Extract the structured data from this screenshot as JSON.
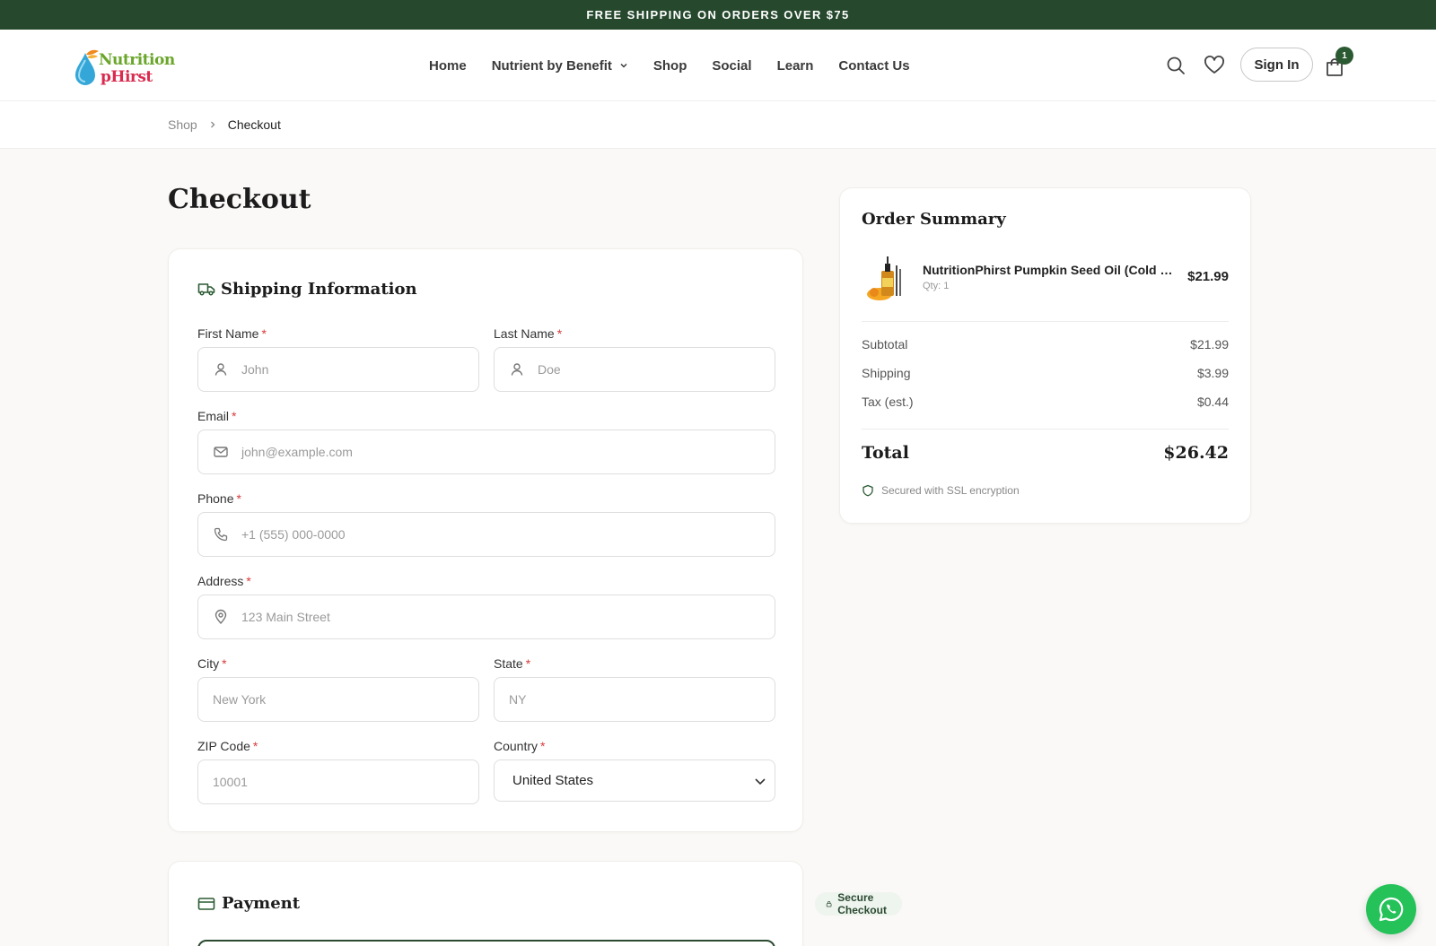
{
  "promo": {
    "text": "FREE SHIPPING ON ORDERS OVER $75"
  },
  "brand": {
    "line1": "Nutrition",
    "line2": "pHirst"
  },
  "nav": {
    "home": "Home",
    "benefit": "Nutrient by Benefit",
    "shop": "Shop",
    "social": "Social",
    "learn": "Learn",
    "contact": "Contact Us"
  },
  "header": {
    "sign_in": "Sign In",
    "cart_count": "1"
  },
  "breadcrumb": {
    "shop": "Shop",
    "current": "Checkout"
  },
  "page": {
    "title": "Checkout"
  },
  "shipping": {
    "title": "Shipping Information",
    "first_name": {
      "label": "First Name",
      "placeholder": "John"
    },
    "last_name": {
      "label": "Last Name",
      "placeholder": "Doe"
    },
    "email": {
      "label": "Email",
      "placeholder": "john@example.com"
    },
    "phone": {
      "label": "Phone",
      "placeholder": "+1 (555) 000-0000"
    },
    "address": {
      "label": "Address",
      "placeholder": "123 Main Street"
    },
    "city": {
      "label": "City",
      "placeholder": "New York"
    },
    "state": {
      "label": "State",
      "placeholder": "NY"
    },
    "zip": {
      "label": "ZIP Code",
      "placeholder": "10001"
    },
    "country": {
      "label": "Country",
      "value": "United States"
    },
    "required_mark": "*"
  },
  "payment": {
    "title": "Payment",
    "secure_label": "Secure Checkout"
  },
  "summary": {
    "title": "Order Summary",
    "item": {
      "name": "NutritionPhirst Pumpkin Seed Oil (Cold Pressed)",
      "qty": "Qty: 1",
      "price": "$21.99"
    },
    "subtotal": {
      "label": "Subtotal",
      "value": "$21.99"
    },
    "shipping": {
      "label": "Shipping",
      "value": "$3.99"
    },
    "tax": {
      "label": "Tax (est.)",
      "value": "$0.44"
    },
    "total": {
      "label": "Total",
      "value": "$26.42"
    },
    "ssl": "Secured with SSL encryption"
  },
  "colors": {
    "brand_dark": "#26492e",
    "accent_green": "#2b5a32",
    "required": "#d93a3a",
    "whatsapp": "#25c25a"
  }
}
